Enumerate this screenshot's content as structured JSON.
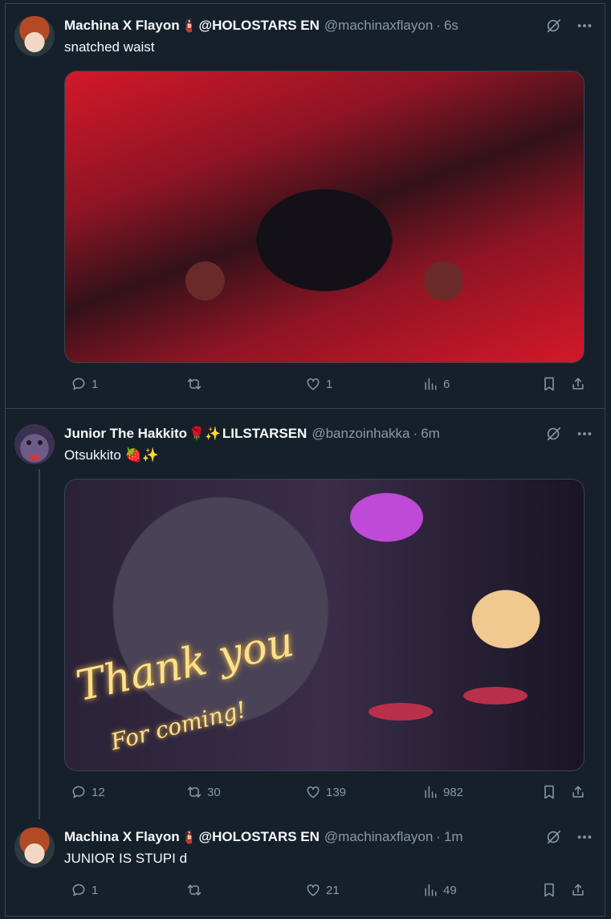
{
  "tweets": [
    {
      "name": "Machina X Flayon",
      "emoji": "🧯",
      "name_suffix": "@HOLOSTARS EN",
      "handle": "@machinaxflayon",
      "time": "6s",
      "text": "snatched waist",
      "stats": {
        "replies": "1",
        "retweets": "",
        "likes": "1",
        "views": "6"
      }
    },
    {
      "name": "Junior The Hakkito",
      "emoji": "🌹✨",
      "name_suffix": "LILSTARSEN",
      "handle": "@banzoinhakka",
      "time": "6m",
      "text": "Otsukkito 🍓✨",
      "media_text": {
        "line1": "Thank you",
        "line2": "For coming!"
      },
      "stats": {
        "replies": "12",
        "retweets": "30",
        "likes": "139",
        "views": "982"
      }
    },
    {
      "name": "Machina X Flayon",
      "emoji": "🧯",
      "name_suffix": "@HOLOSTARS EN",
      "handle": "@machinaxflayon",
      "time": "1m",
      "text": "JUNIOR IS STUPI d",
      "stats": {
        "replies": "1",
        "retweets": "",
        "likes": "21",
        "views": "49"
      }
    }
  ],
  "separator": "·",
  "icons": [
    "grok-icon",
    "more-icon",
    "reply-icon",
    "retweet-icon",
    "like-icon",
    "views-icon",
    "bookmark-icon",
    "share-icon"
  ],
  "colors": {
    "background": "#15202b",
    "border": "#38444d",
    "muted": "#8b98a5",
    "text": "#f7f9f9"
  }
}
